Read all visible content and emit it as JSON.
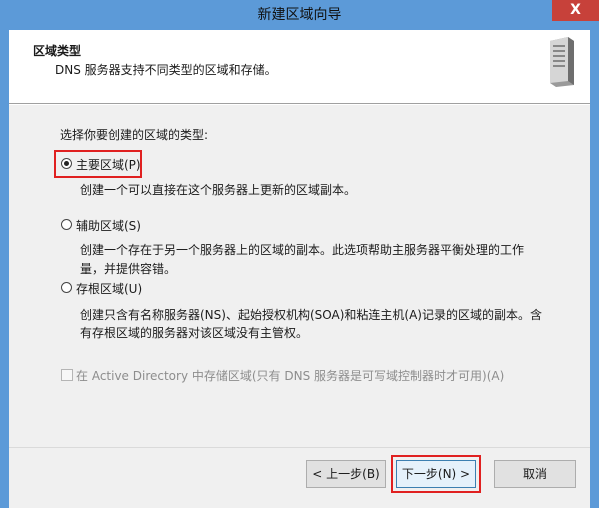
{
  "window": {
    "title": "新建区域向导",
    "close_symbol": "X"
  },
  "header": {
    "title": "区域类型",
    "subtitle": "DNS 服务器支持不同类型的区域和存储。",
    "icon": "server-icon"
  },
  "prompt": "选择你要创建的区域的类型:",
  "options": [
    {
      "label": "主要区域(P)",
      "desc_lines": [
        "创建一个可以直接在这个服务器上更新的区域副本。"
      ],
      "checked": true
    },
    {
      "label": "辅助区域(S)",
      "desc_lines": [
        "创建一个存在于另一个服务器上的区域的副本。此选项帮助主服务器平衡处理的工作",
        "量，并提供容错。"
      ],
      "checked": false
    },
    {
      "label": "存根区域(U)",
      "desc_lines": [
        "创建只含有名称服务器(NS)、起始授权机构(SOA)和粘连主机(A)记录的区域的副本。含",
        "有存根区域的服务器对该区域没有主管权。"
      ],
      "checked": false
    }
  ],
  "ad_checkbox": {
    "label": "在 Active Directory 中存储区域(只有 DNS 服务器是可写域控制器时才可用)(A)",
    "checked": false,
    "enabled": false
  },
  "buttons": {
    "back": "< 上一步(B)",
    "next": "下一步(N) >",
    "cancel": "取消"
  },
  "colors": {
    "titlebar": "#5c9ad8",
    "highlight": "#e02020",
    "close": "#c7413a"
  }
}
